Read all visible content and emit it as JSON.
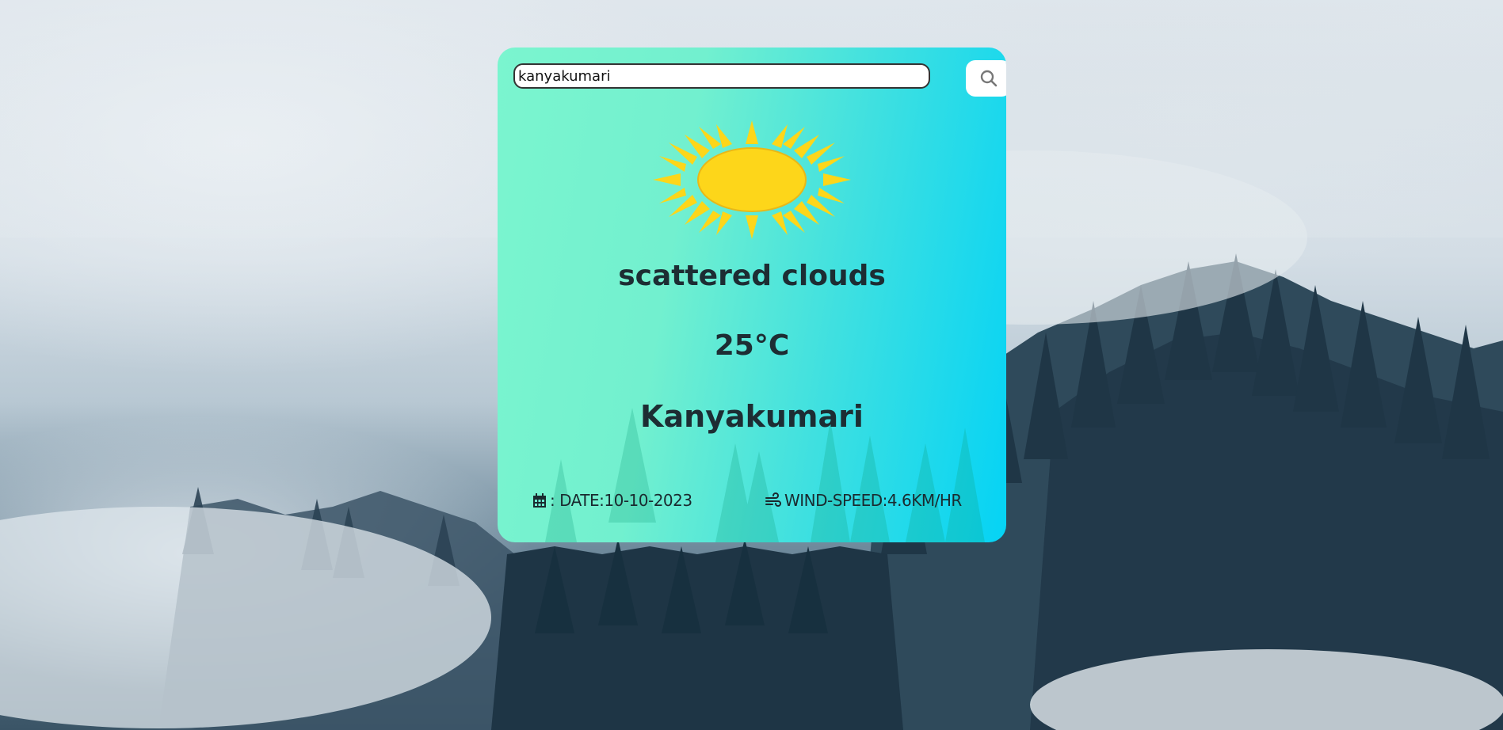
{
  "search": {
    "value": "kanyakumari",
    "button_icon": "search-icon"
  },
  "weather": {
    "icon": "sun-icon",
    "description": "scattered clouds",
    "temperature": "25°C",
    "city": "Kanyakumari"
  },
  "details": {
    "date_icon": "calendar-icon",
    "date_label": ": DATE:10-10-2023",
    "wind_icon": "wind-icon",
    "wind_label": "WIND-SPEED:4.6KM/HR"
  },
  "colors": {
    "card_gradient_start": "#7bf5cf",
    "card_gradient_end": "#05d3f5",
    "sun": "#fdd61a",
    "text": "#1d2d33"
  }
}
